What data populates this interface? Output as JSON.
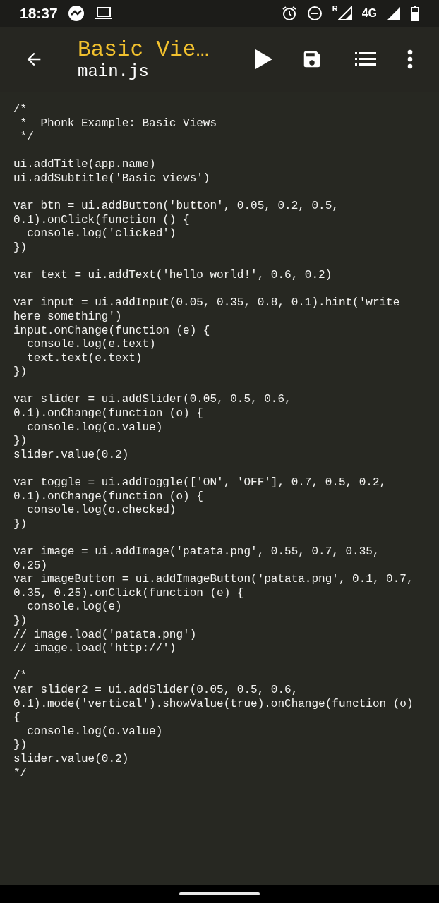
{
  "status_bar": {
    "time": "18:37",
    "roaming": "R",
    "network": "4G"
  },
  "toolbar": {
    "title": "Basic Vie…",
    "subtitle": "main.js"
  },
  "code_blocks": [
    [
      "/*",
      " *  Phonk Example: Basic Views",
      " */"
    ],
    [
      "ui.addTitle(app.name)",
      "ui.addSubtitle('Basic views')"
    ],
    [
      "var btn = ui.addButton('button', 0.05, 0.2, 0.5,",
      "0.1).onClick(function () {",
      "  console.log('clicked')",
      "})"
    ],
    [
      "var text = ui.addText('hello world!', 0.6, 0.2)"
    ],
    [
      "var input = ui.addInput(0.05, 0.35, 0.8, 0.1).hint('write",
      "here something')",
      "input.onChange(function (e) {",
      "  console.log(e.text)",
      "  text.text(e.text)",
      "})"
    ],
    [
      "var slider = ui.addSlider(0.05, 0.5, 0.6,",
      "0.1).onChange(function (o) {",
      "  console.log(o.value)",
      "})",
      "slider.value(0.2)"
    ],
    [
      "var toggle = ui.addToggle(['ON', 'OFF'], 0.7, 0.5, 0.2,",
      "0.1).onChange(function (o) {",
      "  console.log(o.checked)",
      "})"
    ],
    [
      "var image = ui.addImage('patata.png', 0.55, 0.7, 0.35,",
      "0.25)",
      "var imageButton = ui.addImageButton('patata.png', 0.1, 0.7,",
      "0.35, 0.25).onClick(function (e) {",
      "  console.log(e)",
      "})",
      "// image.load('patata.png')",
      "// image.load('http://')"
    ],
    [
      "/*",
      "var slider2 = ui.addSlider(0.05, 0.5, 0.6,",
      "0.1).mode('vertical').showValue(true).onChange(function (o)",
      "{",
      "  console.log(o.value)",
      "})",
      "slider.value(0.2)",
      "*/"
    ]
  ]
}
